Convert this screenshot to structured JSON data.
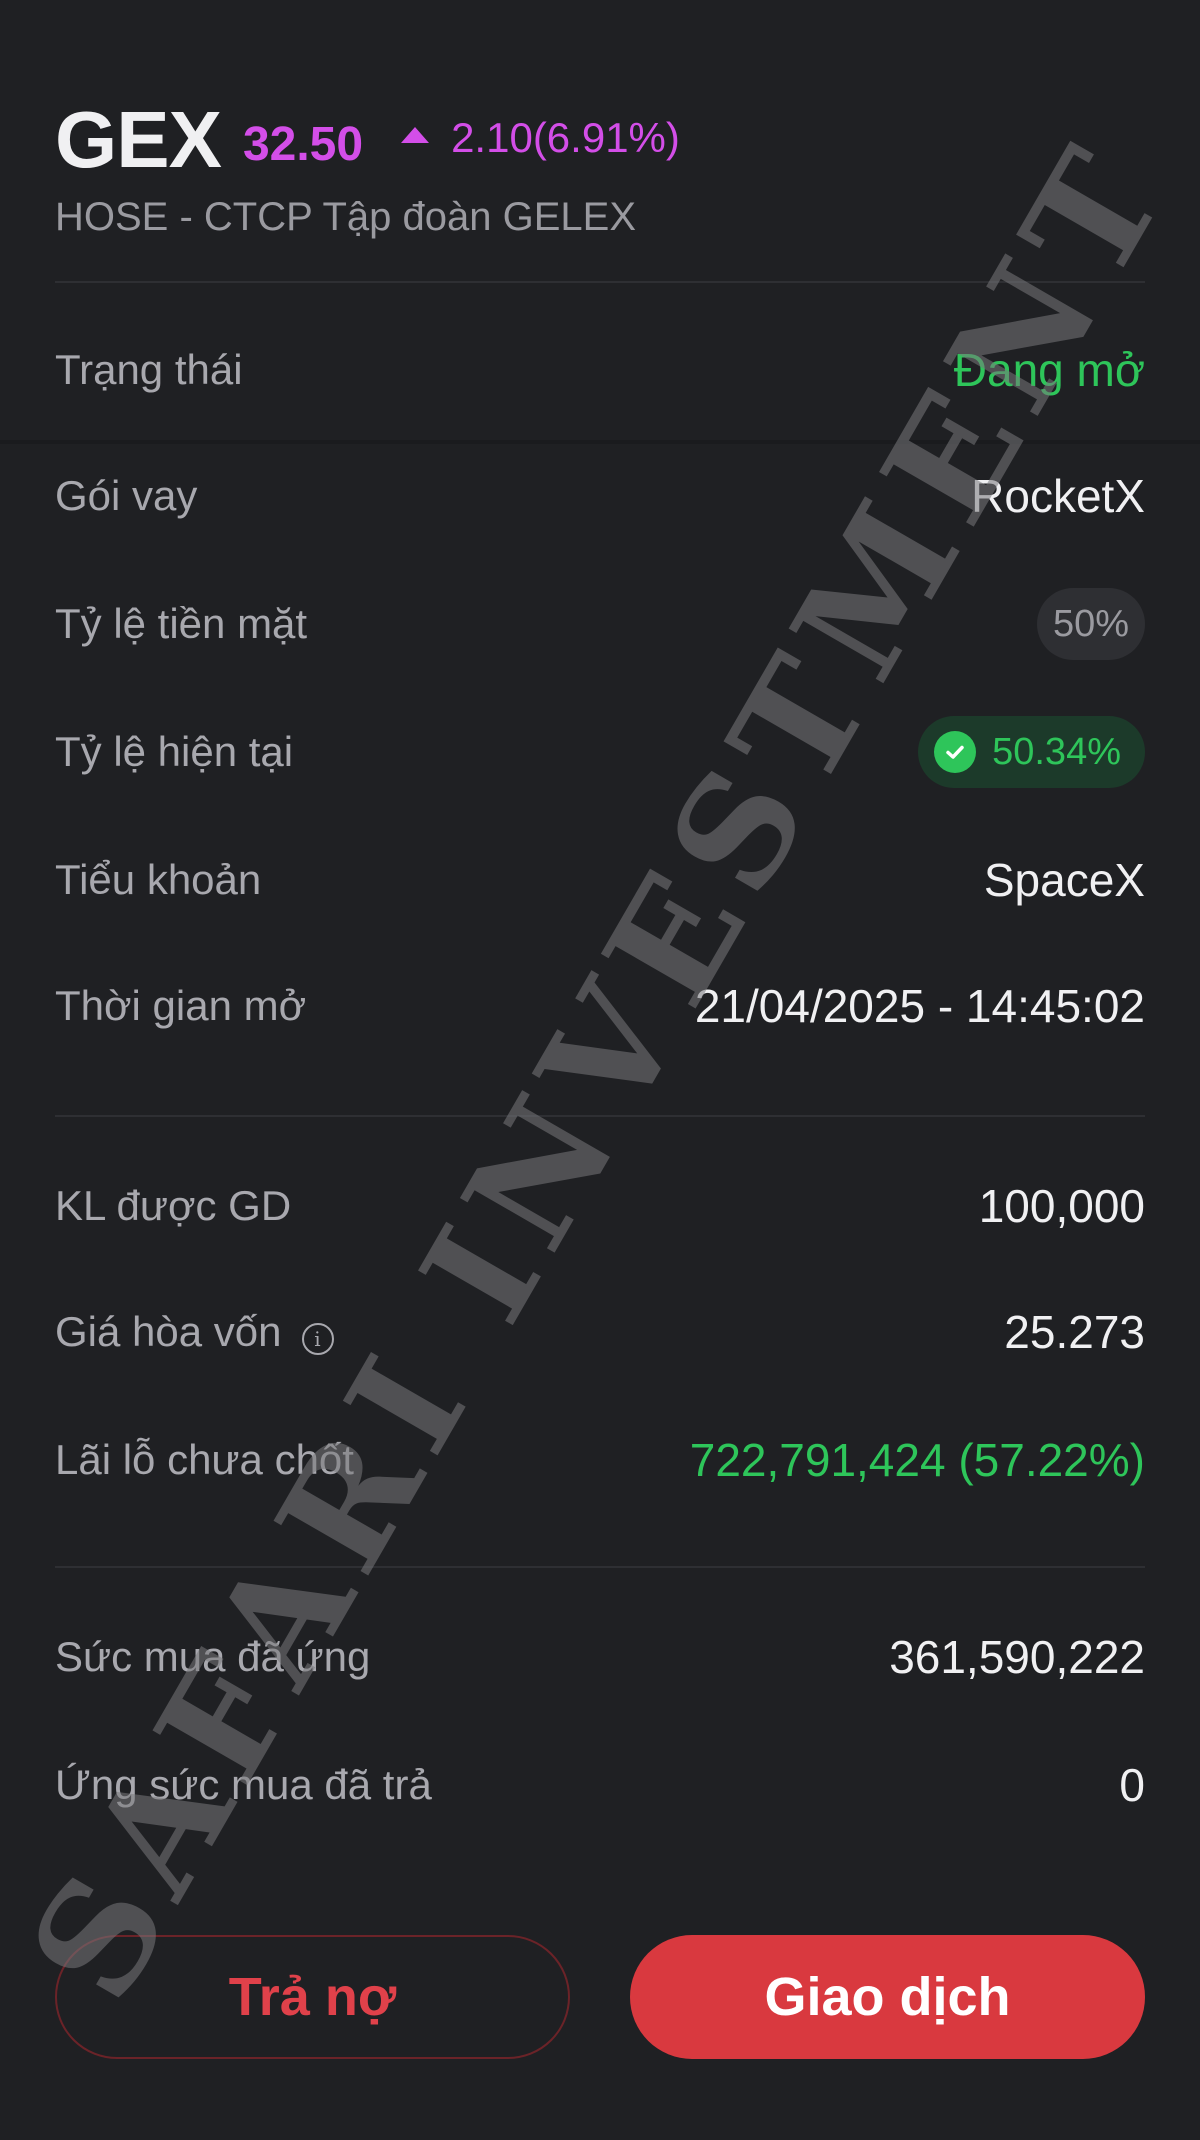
{
  "header": {
    "ticker": "GEX",
    "price": "32.50",
    "change": "2.10(6.91%)",
    "subtitle": "HOSE - CTCP Tập đoàn GELEX"
  },
  "colors": {
    "accent_purple": "#d34ee8",
    "positive_green": "#2ec55a",
    "primary_red": "#d9393f"
  },
  "details": {
    "status_label": "Trạng thái",
    "status_value": "Đang mở",
    "loan_package_label": "Gói vay",
    "loan_package_value": "RocketX",
    "cash_ratio_label": "Tỷ lệ tiền mặt",
    "cash_ratio_value": "50%",
    "current_ratio_label": "Tỷ lệ hiện tại",
    "current_ratio_value": "50.34%",
    "subaccount_label": "Tiểu khoản",
    "subaccount_value": "SpaceX",
    "open_time_label": "Thời gian mở",
    "open_time_value": "21/04/2025 - 14:45:02"
  },
  "position": {
    "volume_label": "KL được GD",
    "volume_value": "100,000",
    "breakeven_label": "Giá hòa vốn",
    "breakeven_value": "25.273",
    "pnl_label": "Lãi lỗ chưa chốt",
    "pnl_value": "722,791,424 (57.22%)"
  },
  "buying_power": {
    "advanced_label": "Sức mua đã ứng",
    "advanced_value": "361,590,222",
    "repaid_label": "Ứng sức mua đã trả",
    "repaid_value": "0"
  },
  "actions": {
    "repay_label": "Trả nợ",
    "trade_label": "Giao dịch"
  },
  "watermark": "SAFARI INVESTMENT"
}
